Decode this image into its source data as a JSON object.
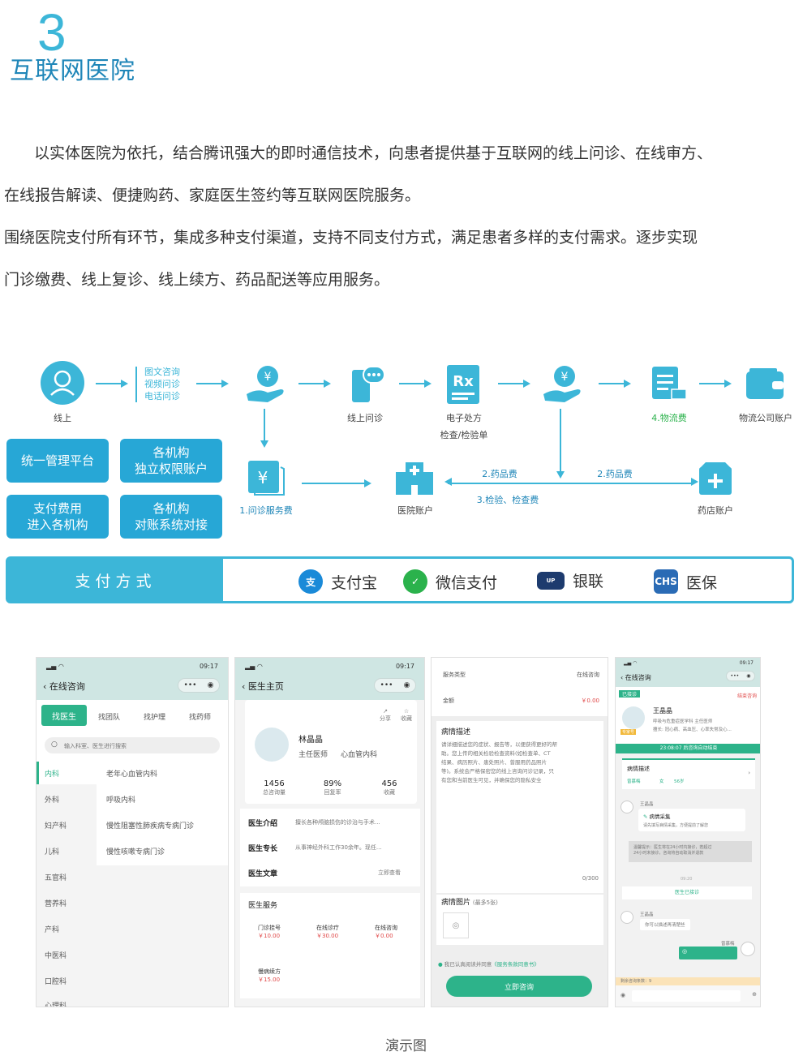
{
  "section": {
    "number": "3",
    "title": "互联网医院"
  },
  "paragraphs": [
    "以实体医院为依托，结合腾讯强大的即时通信技术，向患者提供基于互联网的线上问诊、在线审方、",
    "在线报告解读、便捷购药、家庭医生签约等互联网医院服务。",
    "围绕医院支付所有环节，集成多种支付渠道，支持不同支付方式，满足患者多样的支付需求。逐步实现",
    "门诊缴费、线上复诊、线上续方、药品配送等应用服务。"
  ],
  "flow": {
    "online_label": "线上",
    "consult_types": [
      "图文咨询",
      "视频问诊",
      "电话问诊"
    ],
    "online_consult": "线上问诊",
    "prescription": "电子处方",
    "prescription_sub": "检查/检验单",
    "logistics_fee": "4.物流费",
    "logistics_account": "物流公司账户",
    "consult_fee": "1.问诊服务费",
    "hospital_account": "医院账户",
    "drug_fee_left": "2.药品费",
    "drug_fee_right": "2.药品费",
    "exam_fee": "3.检验、检查费",
    "pharmacy_account": "药店账户",
    "buttons": [
      {
        "line1": "统一管理平台",
        "line2": ""
      },
      {
        "line1": "各机构",
        "line2": "独立权限账户"
      },
      {
        "line1": "支付费用",
        "line2": "进入各机构"
      },
      {
        "line1": "各机构",
        "line2": "对账系统对接"
      }
    ]
  },
  "payment": {
    "heading": "支付方式",
    "methods": [
      {
        "label": "支付宝",
        "icon": "alipay-icon",
        "color": "#1a8ad8"
      },
      {
        "label": "微信支付",
        "icon": "wechat-pay-icon",
        "color": "#2bb24c"
      },
      {
        "label": "银联",
        "icon": "unionpay-icon",
        "color": "#1d3b6e"
      },
      {
        "label": "医保",
        "icon": "chs-icon",
        "color": "#2a6bb5"
      }
    ]
  },
  "phones": {
    "time": "09:17",
    "p1": {
      "title": "在线咨询",
      "tabs": [
        "找医生",
        "找团队",
        "找护理",
        "找药师"
      ],
      "search_placeholder": "输入科室、医生进行搜索",
      "departments": [
        "内科",
        "外科",
        "妇产科",
        "儿科",
        "五官科",
        "营养科",
        "产科",
        "中医科",
        "口腔科",
        "心理科"
      ],
      "subdepts": [
        "老年心血管内科",
        "呼吸内科",
        "慢性阻塞性肺疾病专病门诊",
        "慢性咳嗽专病门诊"
      ]
    },
    "p2": {
      "title": "医生主页",
      "share": "分享",
      "favorite": "收藏",
      "name": "林晶晶",
      "role": "主任医师",
      "dept": "心血管内科",
      "stats": [
        {
          "value": "1456",
          "label": "总咨询量"
        },
        {
          "value": "89%",
          "label": "回复率"
        },
        {
          "value": "456",
          "label": "收藏"
        }
      ],
      "rows": [
        {
          "label": "医生介绍",
          "value": "擅长各种颅脑损伤的诊治与手术..."
        },
        {
          "label": "医生专长",
          "value": "从事神经外科工作30余年。现任..."
        },
        {
          "label": "医生文章",
          "value": "立即查看"
        }
      ],
      "services_title": "医生服务",
      "services": [
        {
          "name": "门诊挂号",
          "price": "￥10.00"
        },
        {
          "name": "在线诊疗",
          "price": "￥30.00"
        },
        {
          "name": "在线咨询",
          "price": "￥0.00"
        },
        {
          "name": "慢病续方",
          "price": "￥15.00"
        }
      ]
    },
    "p3": {
      "service_label": "服务类型",
      "service_value": "在线咨询",
      "amount_label": "金额",
      "amount_value": "￥0.00",
      "desc_title": "病情描述",
      "desc_text": [
        "请详细描述您的症状、报告等，以便获得更好的帮",
        "助。您上传的相关检验检查资料(如检查单、CT",
        "结果、病历照片、患处照片、曾服用药品照片",
        "等)。系统会严格保密您的线上咨询问诊记录，只",
        "有您和当前医生可见，并确保您的隐私安全"
      ],
      "counter": "0/300",
      "img_title": "病情图片",
      "img_hint": "(最多5张)",
      "agree": "我已认真阅读并同意",
      "agree_link": "《服务条款同意书》",
      "submit": "立即咨询"
    },
    "p4": {
      "title": "在线咨询",
      "tag": "已接诊",
      "end": "结束咨询",
      "doctor_name": "王晶晶",
      "doctor_desc": "呼吸与危重症医学科  主任医师",
      "doctor_skill": "擅长: 冠心病、高血压、心率失常及心...",
      "badge": "专家号",
      "banner": "23:08:07 后咨询自动结束",
      "card_title": "病情描述",
      "card_meta": [
        "曾慕梅",
        "女",
        "56岁"
      ],
      "patient": "王晶晶",
      "collect_title": "病情采集",
      "collect_text": "请先填写病情采集，方便提前了解您",
      "notice": [
        "温馨提示：医生将在24小时内接诊，若超过",
        "24小时未接诊，咨询将自动取消并退款"
      ],
      "time2": "09:20",
      "accepted": "医生已接诊",
      "patient2": "王晶晶",
      "msg": "你可以描述再清楚些",
      "reply_name": "曾慕梅",
      "remaining": "剩余咨询条数：9"
    }
  },
  "caption": "演示图"
}
